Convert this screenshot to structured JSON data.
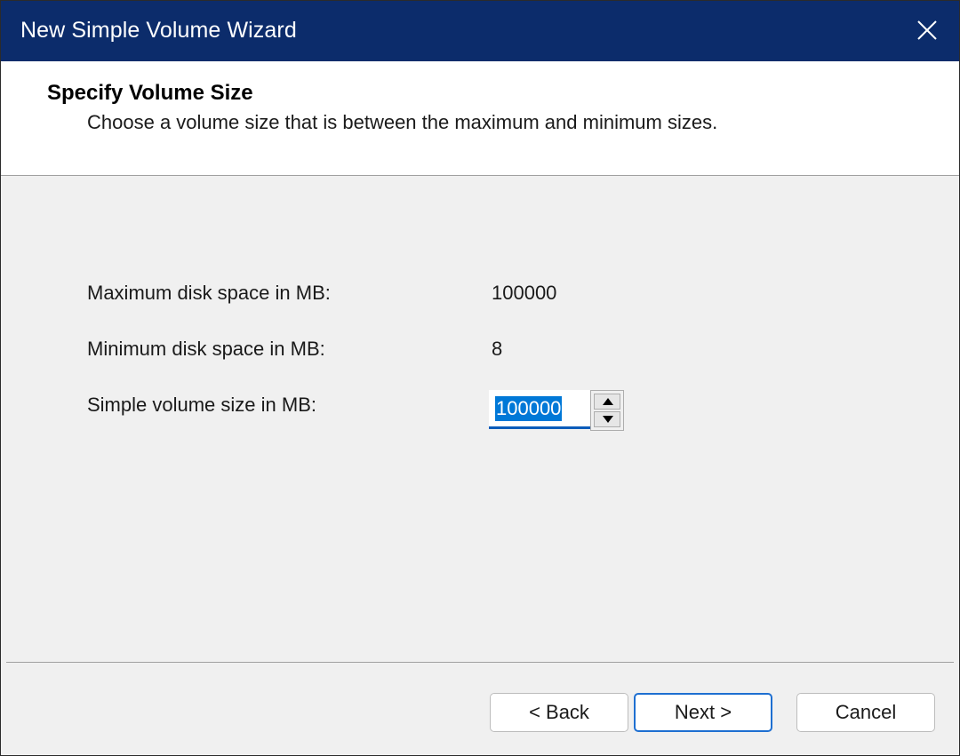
{
  "window": {
    "title": "New Simple Volume Wizard",
    "close_icon": "close-icon"
  },
  "header": {
    "title": "Specify Volume Size",
    "subtitle": "Choose a volume size that is between the maximum and minimum sizes."
  },
  "fields": {
    "max_label": "Maximum disk space in MB:",
    "max_value": "100000",
    "min_label": "Minimum disk space in MB:",
    "min_value": "8",
    "size_label": "Simple volume size in MB:",
    "size_value": "100000"
  },
  "buttons": {
    "back": "< Back",
    "next": "Next >",
    "cancel": "Cancel"
  },
  "colors": {
    "titlebar": "#0c2c6b",
    "selection": "#0078d7",
    "focus_border": "#1e6fd1"
  }
}
